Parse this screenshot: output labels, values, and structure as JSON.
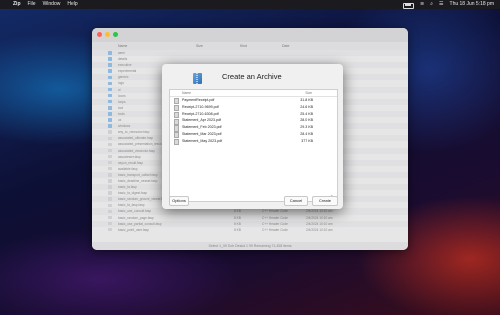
{
  "menubar": {
    "app": "Zip",
    "menus": [
      "File",
      "Window",
      "Help"
    ],
    "clock": "Thu 18 Jun 5:18 pm"
  },
  "background_window": {
    "columns": [
      "Name",
      "Size",
      "Kind",
      "Date"
    ],
    "sidebar_items": [
      "Airport Codes",
      "Icloud"
    ],
    "rows": [
      {
        "name": "aemi",
        "kind": "folder"
      },
      {
        "name": "details",
        "kind": "folder"
      },
      {
        "name": "executive",
        "kind": "folder"
      },
      {
        "name": "experimental",
        "kind": "folder"
      },
      {
        "name": "generic",
        "kind": "folder"
      },
      {
        "name": "logo",
        "kind": "folder"
      },
      {
        "name": "ui",
        "kind": "folder"
      },
      {
        "name": "Icons",
        "kind": "folder"
      },
      {
        "name": "loops",
        "kind": "folder"
      },
      {
        "name": "tool",
        "kind": "folder"
      },
      {
        "name": "tools",
        "kind": "folder"
      },
      {
        "name": "ux",
        "kind": "folder"
      },
      {
        "name": "windows",
        "kind": "folder"
      },
      {
        "name": "any_to_viewcolor.fasp",
        "kind": "doc"
      },
      {
        "name": "associated_ultimate.fasp",
        "kind": "doc"
      },
      {
        "name": "associated_presentation_test.fasp",
        "kind": "doc"
      },
      {
        "name": "associated_viewcolor.fasp",
        "kind": "doc"
      },
      {
        "name": "assoviewer.fasp",
        "kind": "doc"
      },
      {
        "name": "asyon_result.fasp",
        "kind": "doc"
      },
      {
        "name": "available.fasp",
        "kind": "doc"
      },
      {
        "name": "basic_transport_callset.fasp",
        "kind": "doc"
      },
      {
        "name": "basic_deadline_nesset.fasp",
        "kind": "doc"
      },
      {
        "name": "basic_fa.fasp",
        "kind": "doc"
      },
      {
        "name": "basic_fa_digest.fasp",
        "kind": "doc"
      },
      {
        "name": "basic_random_groove_viewer.fasp",
        "kind": "doc"
      },
      {
        "name": "basic_fa_fasp.fasp",
        "kind": "doc"
      },
      {
        "name": "basic_use_consult.fasp",
        "kind": "doc"
      },
      {
        "name": "basic_random_page.fasp",
        "kind": "doc"
      },
      {
        "name": "basic_use_partial_consult.fasp",
        "kind": "doc"
      },
      {
        "name": "basic_point_user.fasp",
        "kind": "doc"
      }
    ],
    "row_details": [
      {
        "size": "8 KB",
        "kind": "C++ Header Code",
        "date": "2/4/2024 10:10 am"
      },
      {
        "size": "8 KB",
        "kind": "C++ Header Code",
        "date": "2/4/2024 10:10 am"
      },
      {
        "size": "8 KB",
        "kind": "C++ Header Code",
        "date": "2/4/2024 10:10 am"
      },
      {
        "size": "8 KB",
        "kind": "C++ Header Code",
        "date": "2/4/2024 10:10 am"
      },
      {
        "size": "8 KB",
        "kind": "C++ Header Code",
        "date": "2/4/2024 10:10 am"
      },
      {
        "size": "8 KB",
        "kind": "C++ Header Code",
        "date": "2/4/2024 10:10 am"
      }
    ],
    "footer": "Select 1_99 Dch Deskd 1 99 Remaining 71,408 items"
  },
  "dialog": {
    "title": "Create an Archive",
    "column_name": "Name",
    "column_size": "Size",
    "files": [
      {
        "name": "PaymentReceipt.pdf",
        "size": "31.8 KB"
      },
      {
        "name": "Receipt-2710-9699.pdf",
        "size": "24.6 KB"
      },
      {
        "name": "Receipt-2710-6308.pdf",
        "size": "25.4 KB"
      },
      {
        "name": "Statement_Apr 2023.pdf",
        "size": "28.0 KB"
      },
      {
        "name": "Statement_Feb 2023.pdf",
        "size": "29.3 KB"
      },
      {
        "name": "Statement_Mar 2023.pdf",
        "size": "28.4 KB"
      },
      {
        "name": "Statement_May 2023.pdf",
        "size": "377 KB"
      }
    ],
    "minus": "–",
    "plus": "+",
    "options_label": "Options",
    "cancel_label": "Cancel",
    "create_label": "Create"
  },
  "colors": {
    "close": "#ff5f57",
    "minimize": "#febc2e",
    "zoom": "#28c840",
    "accent": "#2f6fb3"
  }
}
